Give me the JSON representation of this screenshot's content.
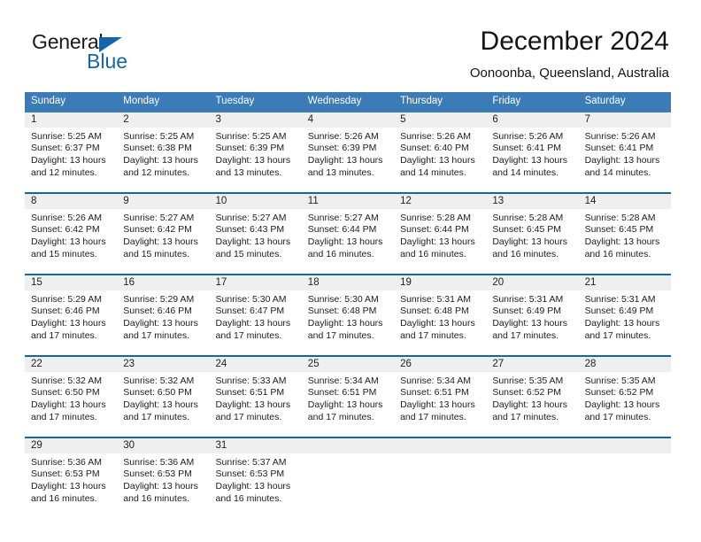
{
  "brand": {
    "word1": "General",
    "word2": "Blue",
    "triangle_color": "#1565a8"
  },
  "header": {
    "title": "December 2024",
    "subtitle": "Oonoonba, Queensland, Australia"
  },
  "colors": {
    "header_band": "#3b7cb8",
    "week_rule": "#1565a8",
    "day_number_band": "#efefef",
    "text": "#202020"
  },
  "weekdays": [
    "Sunday",
    "Monday",
    "Tuesday",
    "Wednesday",
    "Thursday",
    "Friday",
    "Saturday"
  ],
  "labels": {
    "sunrise_prefix": "Sunrise: ",
    "sunset_prefix": "Sunset: ",
    "daylight_prefix": "Daylight: "
  },
  "weeks": [
    [
      {
        "day": "1",
        "sunrise": "Sunrise: 5:25 AM",
        "sunset": "Sunset: 6:37 PM",
        "daylight": "Daylight: 13 hours and 12 minutes."
      },
      {
        "day": "2",
        "sunrise": "Sunrise: 5:25 AM",
        "sunset": "Sunset: 6:38 PM",
        "daylight": "Daylight: 13 hours and 12 minutes."
      },
      {
        "day": "3",
        "sunrise": "Sunrise: 5:25 AM",
        "sunset": "Sunset: 6:39 PM",
        "daylight": "Daylight: 13 hours and 13 minutes."
      },
      {
        "day": "4",
        "sunrise": "Sunrise: 5:26 AM",
        "sunset": "Sunset: 6:39 PM",
        "daylight": "Daylight: 13 hours and 13 minutes."
      },
      {
        "day": "5",
        "sunrise": "Sunrise: 5:26 AM",
        "sunset": "Sunset: 6:40 PM",
        "daylight": "Daylight: 13 hours and 14 minutes."
      },
      {
        "day": "6",
        "sunrise": "Sunrise: 5:26 AM",
        "sunset": "Sunset: 6:41 PM",
        "daylight": "Daylight: 13 hours and 14 minutes."
      },
      {
        "day": "7",
        "sunrise": "Sunrise: 5:26 AM",
        "sunset": "Sunset: 6:41 PM",
        "daylight": "Daylight: 13 hours and 14 minutes."
      }
    ],
    [
      {
        "day": "8",
        "sunrise": "Sunrise: 5:26 AM",
        "sunset": "Sunset: 6:42 PM",
        "daylight": "Daylight: 13 hours and 15 minutes."
      },
      {
        "day": "9",
        "sunrise": "Sunrise: 5:27 AM",
        "sunset": "Sunset: 6:42 PM",
        "daylight": "Daylight: 13 hours and 15 minutes."
      },
      {
        "day": "10",
        "sunrise": "Sunrise: 5:27 AM",
        "sunset": "Sunset: 6:43 PM",
        "daylight": "Daylight: 13 hours and 15 minutes."
      },
      {
        "day": "11",
        "sunrise": "Sunrise: 5:27 AM",
        "sunset": "Sunset: 6:44 PM",
        "daylight": "Daylight: 13 hours and 16 minutes."
      },
      {
        "day": "12",
        "sunrise": "Sunrise: 5:28 AM",
        "sunset": "Sunset: 6:44 PM",
        "daylight": "Daylight: 13 hours and 16 minutes."
      },
      {
        "day": "13",
        "sunrise": "Sunrise: 5:28 AM",
        "sunset": "Sunset: 6:45 PM",
        "daylight": "Daylight: 13 hours and 16 minutes."
      },
      {
        "day": "14",
        "sunrise": "Sunrise: 5:28 AM",
        "sunset": "Sunset: 6:45 PM",
        "daylight": "Daylight: 13 hours and 16 minutes."
      }
    ],
    [
      {
        "day": "15",
        "sunrise": "Sunrise: 5:29 AM",
        "sunset": "Sunset: 6:46 PM",
        "daylight": "Daylight: 13 hours and 17 minutes."
      },
      {
        "day": "16",
        "sunrise": "Sunrise: 5:29 AM",
        "sunset": "Sunset: 6:46 PM",
        "daylight": "Daylight: 13 hours and 17 minutes."
      },
      {
        "day": "17",
        "sunrise": "Sunrise: 5:30 AM",
        "sunset": "Sunset: 6:47 PM",
        "daylight": "Daylight: 13 hours and 17 minutes."
      },
      {
        "day": "18",
        "sunrise": "Sunrise: 5:30 AM",
        "sunset": "Sunset: 6:48 PM",
        "daylight": "Daylight: 13 hours and 17 minutes."
      },
      {
        "day": "19",
        "sunrise": "Sunrise: 5:31 AM",
        "sunset": "Sunset: 6:48 PM",
        "daylight": "Daylight: 13 hours and 17 minutes."
      },
      {
        "day": "20",
        "sunrise": "Sunrise: 5:31 AM",
        "sunset": "Sunset: 6:49 PM",
        "daylight": "Daylight: 13 hours and 17 minutes."
      },
      {
        "day": "21",
        "sunrise": "Sunrise: 5:31 AM",
        "sunset": "Sunset: 6:49 PM",
        "daylight": "Daylight: 13 hours and 17 minutes."
      }
    ],
    [
      {
        "day": "22",
        "sunrise": "Sunrise: 5:32 AM",
        "sunset": "Sunset: 6:50 PM",
        "daylight": "Daylight: 13 hours and 17 minutes."
      },
      {
        "day": "23",
        "sunrise": "Sunrise: 5:32 AM",
        "sunset": "Sunset: 6:50 PM",
        "daylight": "Daylight: 13 hours and 17 minutes."
      },
      {
        "day": "24",
        "sunrise": "Sunrise: 5:33 AM",
        "sunset": "Sunset: 6:51 PM",
        "daylight": "Daylight: 13 hours and 17 minutes."
      },
      {
        "day": "25",
        "sunrise": "Sunrise: 5:34 AM",
        "sunset": "Sunset: 6:51 PM",
        "daylight": "Daylight: 13 hours and 17 minutes."
      },
      {
        "day": "26",
        "sunrise": "Sunrise: 5:34 AM",
        "sunset": "Sunset: 6:51 PM",
        "daylight": "Daylight: 13 hours and 17 minutes."
      },
      {
        "day": "27",
        "sunrise": "Sunrise: 5:35 AM",
        "sunset": "Sunset: 6:52 PM",
        "daylight": "Daylight: 13 hours and 17 minutes."
      },
      {
        "day": "28",
        "sunrise": "Sunrise: 5:35 AM",
        "sunset": "Sunset: 6:52 PM",
        "daylight": "Daylight: 13 hours and 17 minutes."
      }
    ],
    [
      {
        "day": "29",
        "sunrise": "Sunrise: 5:36 AM",
        "sunset": "Sunset: 6:53 PM",
        "daylight": "Daylight: 13 hours and 16 minutes."
      },
      {
        "day": "30",
        "sunrise": "Sunrise: 5:36 AM",
        "sunset": "Sunset: 6:53 PM",
        "daylight": "Daylight: 13 hours and 16 minutes."
      },
      {
        "day": "31",
        "sunrise": "Sunrise: 5:37 AM",
        "sunset": "Sunset: 6:53 PM",
        "daylight": "Daylight: 13 hours and 16 minutes."
      },
      {
        "day": "",
        "sunrise": "",
        "sunset": "",
        "daylight": ""
      },
      {
        "day": "",
        "sunrise": "",
        "sunset": "",
        "daylight": ""
      },
      {
        "day": "",
        "sunrise": "",
        "sunset": "",
        "daylight": ""
      },
      {
        "day": "",
        "sunrise": "",
        "sunset": "",
        "daylight": ""
      }
    ]
  ]
}
